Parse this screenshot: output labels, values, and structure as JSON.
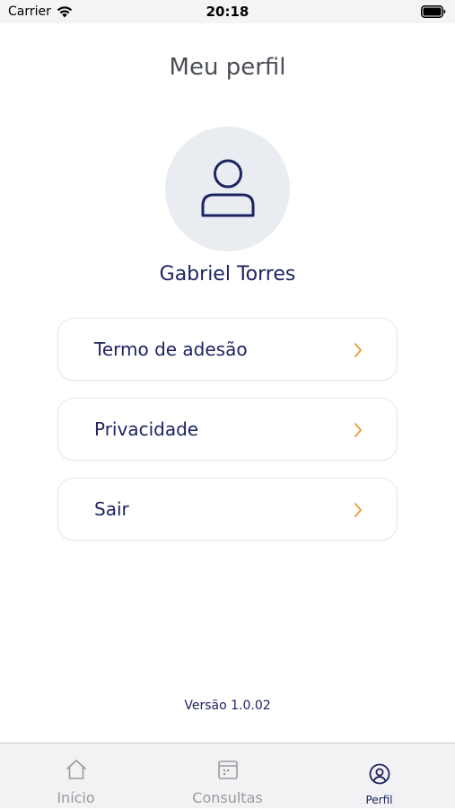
{
  "status_bar": {
    "carrier": "Carrier",
    "time": "20:18"
  },
  "header": {
    "title": "Meu perfil"
  },
  "profile": {
    "name": "Gabriel Torres"
  },
  "menu": {
    "items": [
      {
        "label": "Termo de adesão"
      },
      {
        "label": "Privacidade"
      },
      {
        "label": "Sair"
      }
    ]
  },
  "footer": {
    "version": "Versão 1.0.02"
  },
  "tab_bar": {
    "tabs": [
      {
        "label": "Início",
        "icon": "home-icon",
        "active": false
      },
      {
        "label": "Consultas",
        "icon": "calendar-icon",
        "active": false
      },
      {
        "label": "Perfil",
        "icon": "profile-icon",
        "active": true
      }
    ]
  },
  "colors": {
    "primary": "#1c2461",
    "accent": "#e8a33d",
    "inactive": "#9a9a9e",
    "avatar_bg": "#e9ecf0"
  }
}
